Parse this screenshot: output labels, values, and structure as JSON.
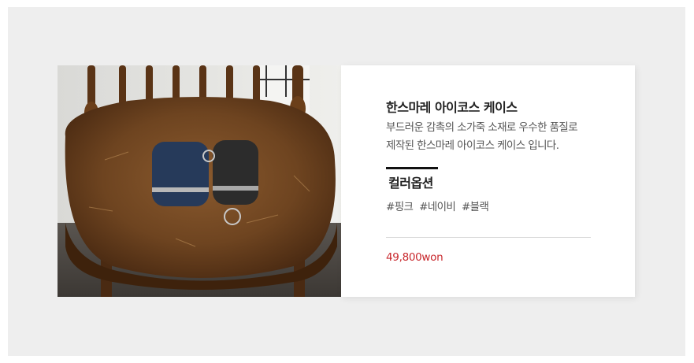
{
  "product": {
    "title": "한스마레 아이코스 케이스",
    "description_lines": [
      "부드러운 감촉의 소가죽 소재로 우수한 품질로",
      "제작된 한스마레 아이코스 케이스 입니다."
    ],
    "option_title": "컬러옵션",
    "color_tags": [
      "#핑크",
      "#네이비",
      "#블랙"
    ],
    "price": "49,800won"
  },
  "colors": {
    "page_background": "#eeeeee",
    "card_background": "#ffffff",
    "price_color": "#c8272c",
    "accent_bar": "#111111"
  }
}
